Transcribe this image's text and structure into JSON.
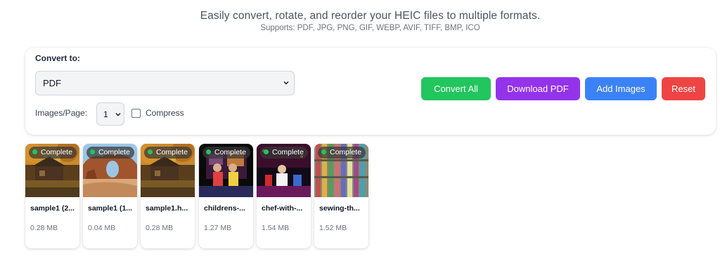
{
  "header": {
    "title": "Easily convert, rotate, and reorder your HEIC files to multiple formats.",
    "subtitle": "Supports: PDF, JPG, PNG, GIF, WEBP, AVIF, TIFF, BMP, ICO"
  },
  "controls": {
    "convert_to_label": "Convert to:",
    "format_selected": "PDF",
    "images_per_page_label": "Images/Page:",
    "images_per_page_selected": "1",
    "compress_label": "Compress",
    "compress_checked": false
  },
  "buttons": {
    "convert_all": "Convert All",
    "download_pdf": "Download PDF",
    "add_images": "Add Images",
    "reset": "Reset"
  },
  "colors": {
    "convert_all": "#22c55e",
    "download_pdf": "#9333ea",
    "add_images": "#3b82f6",
    "reset": "#ef4444",
    "status_dot": "#22c55e"
  },
  "files": [
    {
      "name": "sample1 (2...",
      "size": "0.28 MB",
      "status": "Complete",
      "thumb": "autumn-cabin"
    },
    {
      "name": "sample1 (1...",
      "size": "0.04 MB",
      "status": "Complete",
      "thumb": "desert-arch"
    },
    {
      "name": "sample1.h...",
      "size": "0.28 MB",
      "status": "Complete",
      "thumb": "autumn-cabin"
    },
    {
      "name": "childrens-...",
      "size": "1.27 MB",
      "status": "Complete",
      "thumb": "stage-children"
    },
    {
      "name": "chef-with-...",
      "size": "1.54 MB",
      "status": "Complete",
      "thumb": "stage-chef"
    },
    {
      "name": "sewing-th...",
      "size": "1.52 MB",
      "status": "Complete",
      "thumb": "thread-spools"
    }
  ]
}
